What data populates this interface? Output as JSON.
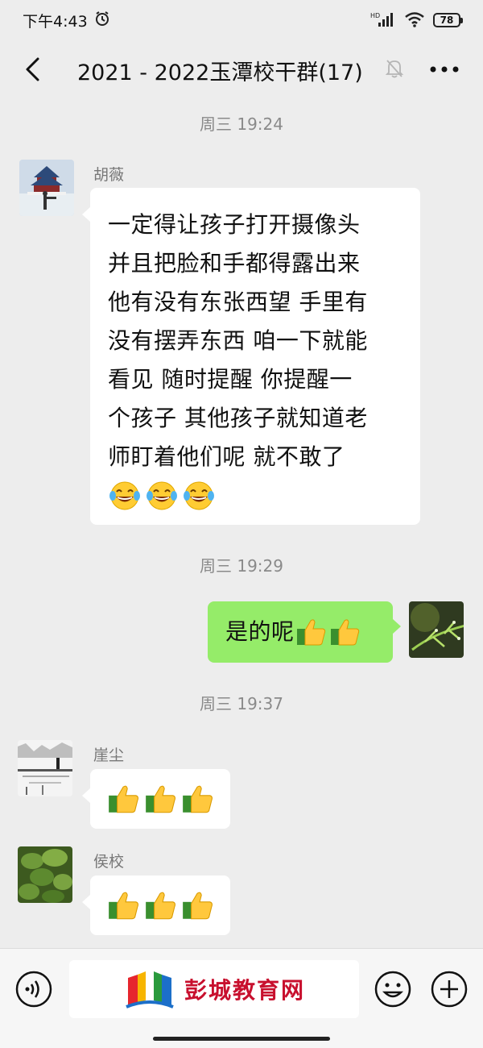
{
  "status_bar": {
    "time": "下午4:43",
    "network": "HD",
    "battery": "78"
  },
  "nav": {
    "title": "2021 - 2022玉潭校干群(17)"
  },
  "messages": [
    {
      "time": "周三 19:24",
      "sender": "胡薇",
      "text_lines": [
        "一定得让孩子打开摄像头",
        "并且把脸和手都得露出来",
        "他有没有东张西望 手里有",
        "没有摆弄东西 咱一下就能",
        "看见 随时提醒 你提醒一",
        "个孩子 其他孩子就知道老",
        "师盯着他们呢 就不敢了"
      ],
      "emoji": [
        "laughing-crying",
        "laughing-crying",
        "laughing-crying"
      ]
    },
    {
      "time": "周三 19:29",
      "sender": "me",
      "text": "是的呢",
      "emoji": [
        "thumbs-up",
        "thumbs-up"
      ]
    },
    {
      "time": "周三 19:37",
      "sender": "崖尘",
      "emoji": [
        "thumbs-up",
        "thumbs-up",
        "thumbs-up"
      ]
    },
    {
      "sender": "侯校",
      "emoji": [
        "thumbs-up",
        "thumbs-up",
        "thumbs-up"
      ]
    }
  ],
  "input_bar": {
    "watermark_logo_text": "彭城教育网"
  },
  "colors": {
    "background": "#ededed",
    "bubble_self": "#95ec69",
    "bubble_other": "#ffffff",
    "watermark_red": "#c8102e"
  }
}
